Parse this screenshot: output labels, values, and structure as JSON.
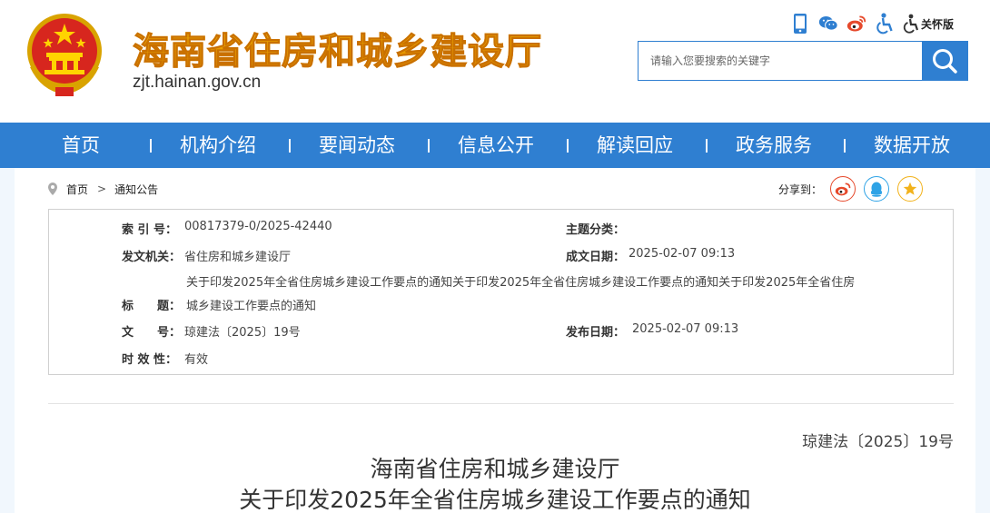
{
  "header": {
    "site_title": "海南省住房和城乡建设厅",
    "site_domain": "zjt.hainan.gov.cn",
    "care_mode_label": "关怀版",
    "search_placeholder": "请输入您要搜索的关键字",
    "icons": [
      "mobile-icon",
      "wechat-icon",
      "weibo-icon",
      "accessibility-icon",
      "care-mode-icon",
      "search-icon"
    ]
  },
  "nav": {
    "items": [
      "首页",
      "机构介绍",
      "要闻动态",
      "信息公开",
      "解读回应",
      "政务服务",
      "数据开放"
    ]
  },
  "breadcrumb": {
    "home": "首页",
    "separator": ">",
    "current": "通知公告"
  },
  "share": {
    "label": "分享到："
  },
  "info": {
    "index_label": "索 引 号：",
    "index_value": "00817379-0/2025-42440",
    "topic_label": "主题分类：",
    "topic_value": "",
    "issuer_label": "发文机关：",
    "issuer_value": "省住房和城乡建设厅",
    "created_label": "成文日期：",
    "created_value": "2025-02-07 09:13",
    "title_label": "标　　题：",
    "title_line1": "关于印发2025年全省住房城乡建设工作要点的通知关于印发2025年全省住房城乡建设工作要点的通知关于印发2025年全省住房",
    "title_line2": "城乡建设工作要点的通知",
    "docno_label": "文　　号：",
    "docno_value": "琼建法〔2025〕19号",
    "published_label": "发布日期：",
    "published_value": "2025-02-07 09:13",
    "validity_label": "时 效 性：",
    "validity_value": "有效"
  },
  "document": {
    "number": "琼建法〔2025〕19号",
    "title_line1": "海南省住房和城乡建设厅",
    "title_line2": "关于印发2025年全省住房城乡建设工作要点的通知"
  },
  "colors": {
    "nav_blue": "#2f7fd1",
    "title_gold": "#e79a00",
    "weibo_red": "#e6492b",
    "qq_blue": "#2fa3e6",
    "qzone_yellow": "#f2b21b"
  }
}
